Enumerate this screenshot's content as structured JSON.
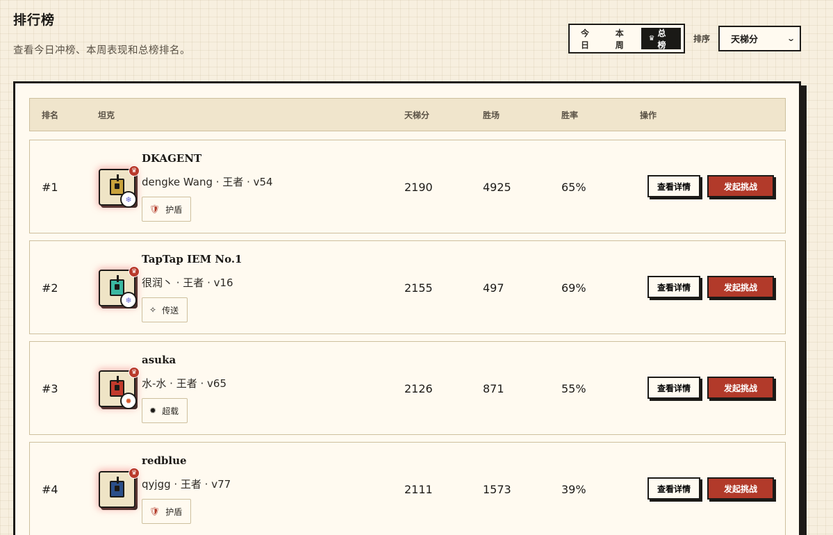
{
  "header": {
    "title": "排行榜",
    "subtitle": "查看今日冲榜、本周表现和总榜排名。"
  },
  "period_tabs": [
    {
      "label": "今日",
      "active": false
    },
    {
      "label": "本周",
      "active": false
    },
    {
      "label": "总榜",
      "active": true,
      "icon": "crown-icon"
    }
  ],
  "sort": {
    "label": "排序",
    "selected": "天梯分"
  },
  "table": {
    "columns": [
      "排名",
      "坦克",
      "天梯分",
      "胜场",
      "胜率",
      "操作"
    ],
    "actions": {
      "detail": "查看详情",
      "challenge": "发起挑战"
    },
    "rows": [
      {
        "rank": "#1",
        "name": "DKAGENT",
        "meta": "dengke Wang · 王者 · v54",
        "score": "2190",
        "wins": "4925",
        "rate": "65%",
        "skill": "护盾",
        "skill_icon": "shield-icon",
        "tank_color": "#c9a23c",
        "ability_icon": "snowflake-icon"
      },
      {
        "rank": "#2",
        "name": "TapTap IEM No.1",
        "meta": "很润丶 · 王者 · v16",
        "score": "2155",
        "wins": "497",
        "rate": "69%",
        "skill": "传送",
        "skill_icon": "sparkle-icon",
        "tank_color": "#3bb8a2",
        "ability_icon": "snowflake-icon"
      },
      {
        "rank": "#3",
        "name": "asuka",
        "meta": "水-水 · 王者 · v65",
        "score": "2126",
        "wins": "871",
        "rate": "55%",
        "skill": "超载",
        "skill_icon": "burst-icon",
        "tank_color": "#c23a2c",
        "ability_icon": "burst-icon"
      },
      {
        "rank": "#4",
        "name": "redblue",
        "meta": "qyjgg · 王者 · v77",
        "score": "2111",
        "wins": "1573",
        "rate": "39%",
        "skill": "护盾",
        "skill_icon": "shield-icon",
        "tank_color": "#2b4f8a",
        "ability_icon": "none"
      }
    ]
  }
}
